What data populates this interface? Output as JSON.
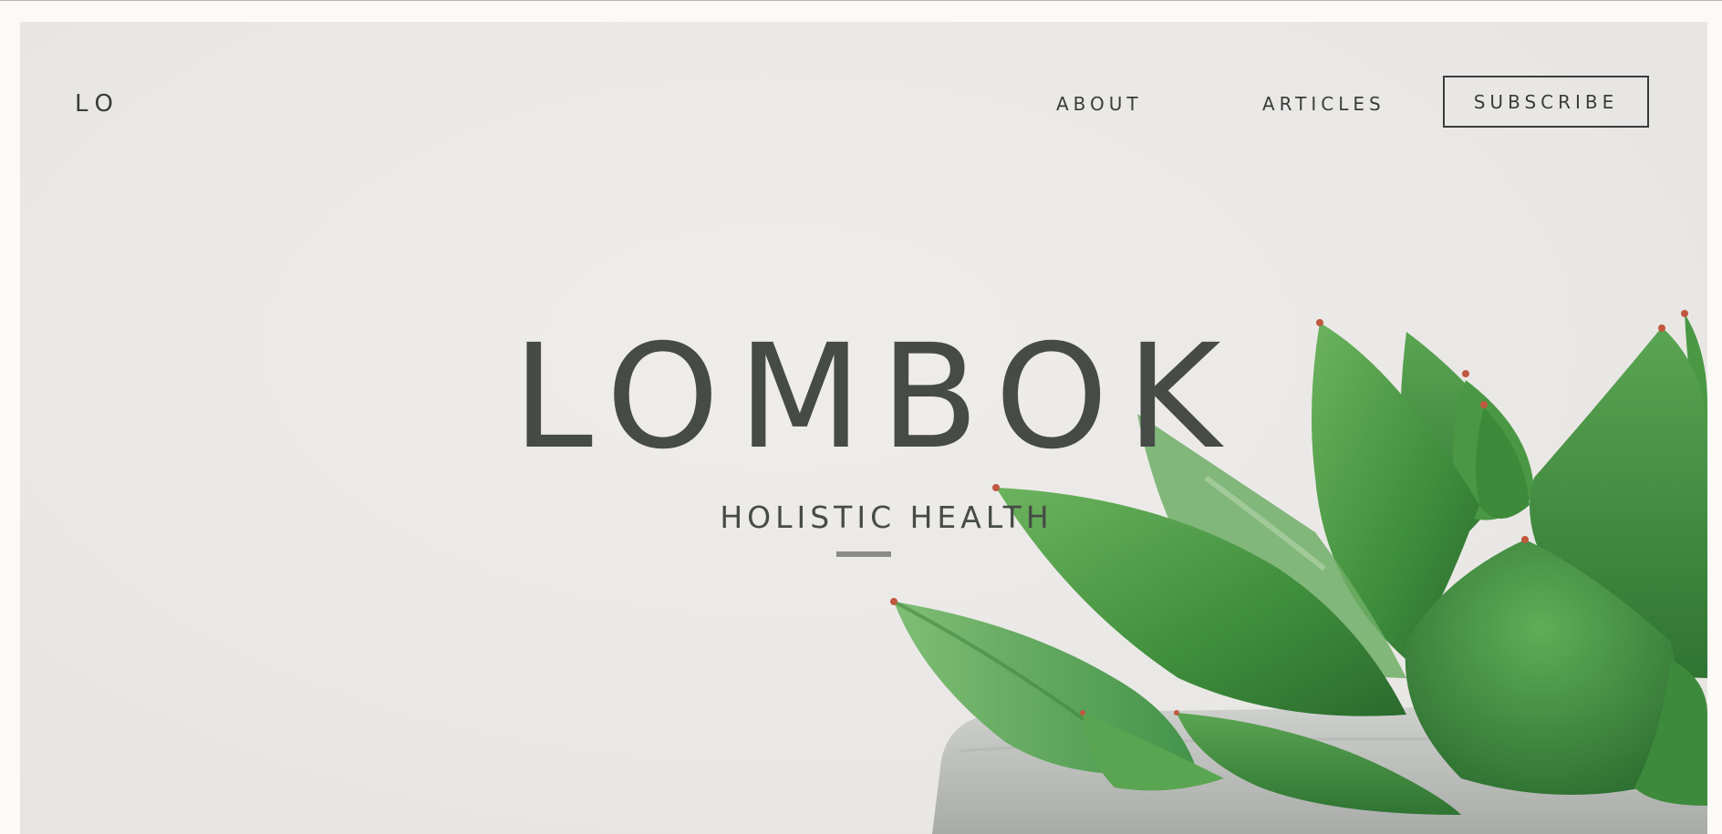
{
  "header": {
    "logo": "LO",
    "nav": {
      "about": "ABOUT",
      "articles": "ARTICLES",
      "subscribe": "SUBSCRIBE"
    }
  },
  "hero": {
    "title": "LOMBOK",
    "subtitle": "HOLISTIC HEALTH",
    "image": "succulent-in-concrete-pot"
  },
  "colors": {
    "text": "#474b47",
    "background": "#eae8e6",
    "plant_green": "#4f9a48"
  }
}
